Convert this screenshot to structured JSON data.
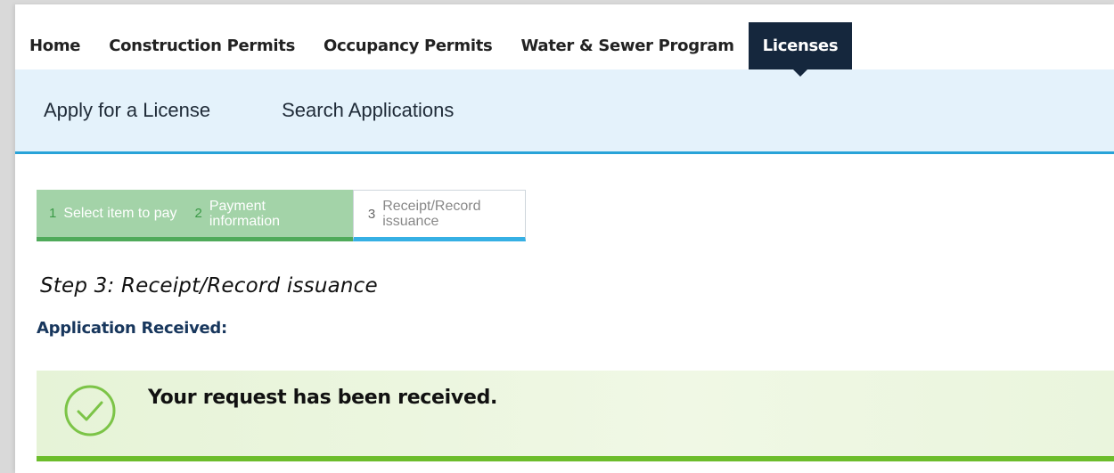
{
  "nav": {
    "tabs": [
      {
        "label": "Home"
      },
      {
        "label": "Construction Permits"
      },
      {
        "label": "Occupancy Permits"
      },
      {
        "label": "Water & Sewer Program"
      },
      {
        "label": "Licenses"
      }
    ],
    "active_tab": "Licenses"
  },
  "subnav": {
    "items": [
      {
        "label": "Apply for a License"
      },
      {
        "label": "Search Applications"
      }
    ]
  },
  "stepper": {
    "steps": [
      {
        "number": "1",
        "label": "Select item to pay",
        "state": "done"
      },
      {
        "number": "2",
        "label": "Payment information",
        "state": "done"
      },
      {
        "number": "3",
        "label": "Receipt/Record issuance",
        "state": "current"
      }
    ]
  },
  "page": {
    "step_title": "Step 3: Receipt/Record issuance",
    "section_title": "Application Received:"
  },
  "notice": {
    "icon": "check-circle-icon",
    "message": "Your request has been received."
  },
  "colors": {
    "nav_active_bg": "#15273d",
    "subnav_bg": "#e4f2fb",
    "subnav_border": "#28a3d8",
    "step_done_bg": "#a3d3a8",
    "step_done_border": "#4faa5a",
    "step_current_border": "#36b0e4",
    "notice_border": "#6cbd2b",
    "check_color": "#7cc447"
  }
}
